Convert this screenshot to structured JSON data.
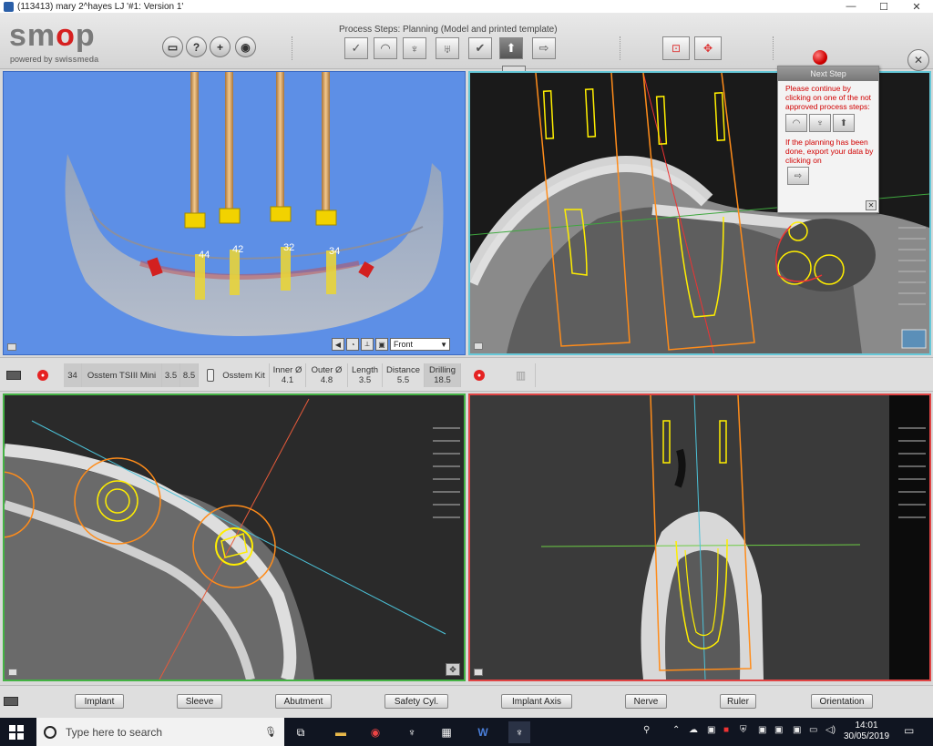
{
  "window": {
    "title": "(113413) mary 2^hayes LJ  '#1: Version 1'"
  },
  "branding": {
    "logo_text": "smop",
    "powered_prefix": "powered by",
    "powered_brand": "swissmeda"
  },
  "process": {
    "label": "Process Steps: Planning (Model and printed template)"
  },
  "panel3d": {
    "implant_numbers": [
      "44",
      "42",
      "32",
      "34"
    ],
    "view_select": "Front"
  },
  "next_step": {
    "header": "Next Step",
    "text1": "Please continue by clicking on one of the not approved process steps:",
    "text2": "If the planning has been done, export your data by clicking on"
  },
  "info": {
    "tooth": "34",
    "implant_name": "Osstem TSIII Mini",
    "diameter": "3.5",
    "length_val": "8.5",
    "kit": "Osstem Kit",
    "inner_label": "Inner Ø",
    "inner_val": "4.1",
    "outer_label": "Outer Ø",
    "outer_val": "4.8",
    "length_label": "Length",
    "length_val2": "3.5",
    "distance_label": "Distance",
    "distance_val": "5.5",
    "drilling_label": "Drilling",
    "drilling_val": "18.5"
  },
  "bottom_buttons": [
    "Implant",
    "Sleeve",
    "Abutment",
    "Safety Cyl.",
    "Implant Axis",
    "Nerve",
    "Ruler",
    "Orientation"
  ],
  "taskbar": {
    "search_placeholder": "Type here to search",
    "time": "14:01",
    "date": "30/05/2019"
  },
  "colors": {
    "accent_red": "#d62020",
    "panel3d_bg": "#5d8fe6",
    "implant_yellow": "#ffee00",
    "sleeve_orange": "#ff8c1a"
  }
}
